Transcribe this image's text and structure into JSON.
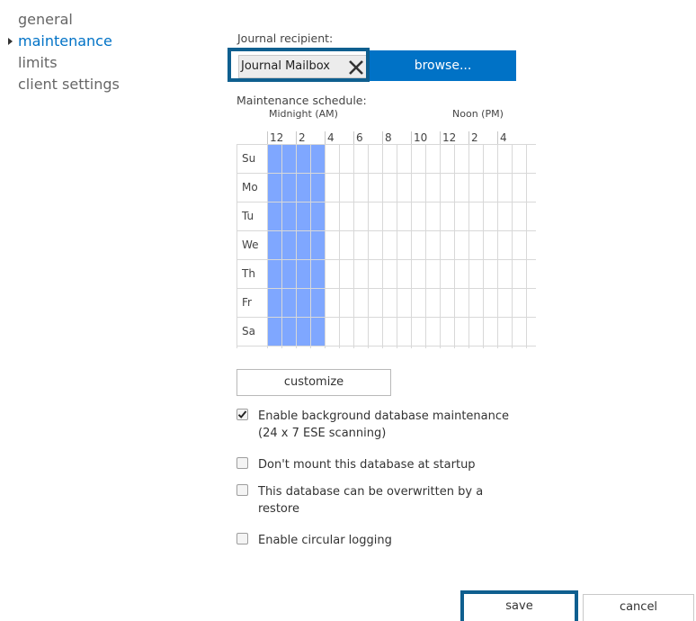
{
  "nav": {
    "items": [
      {
        "label": "general",
        "active": false
      },
      {
        "label": "maintenance",
        "active": true
      },
      {
        "label": "limits",
        "active": false
      },
      {
        "label": "client settings",
        "active": false
      }
    ]
  },
  "journal": {
    "label": "Journal recipient:",
    "value": "Journal Mailbox",
    "remove_icon": "close-x-icon",
    "browse_label": "browse..."
  },
  "schedule": {
    "label": "Maintenance schedule:",
    "midnight_label": "Midnight (AM)",
    "noon_label": "Noon (PM)",
    "hour_ticks": [
      "12",
      "2",
      "4",
      "6",
      "8",
      "10",
      "12",
      "2",
      "4"
    ],
    "days": [
      "Su",
      "Mo",
      "Tu",
      "We",
      "Th",
      "Fr",
      "Sa"
    ],
    "selected_hours": [
      1,
      2,
      3,
      4
    ],
    "selected_color": "#7fa7ff",
    "customize_label": "customize"
  },
  "options": [
    {
      "label": "Enable background database maintenance (24 x 7 ESE scanning)",
      "checked": true
    },
    {
      "label": "Don't mount this database at startup",
      "checked": false
    },
    {
      "label": "This database can be overwritten by a restore",
      "checked": false
    },
    {
      "label": "Enable circular logging",
      "checked": false
    }
  ],
  "footer": {
    "save_label": "save",
    "cancel_label": "cancel"
  },
  "colors": {
    "accent": "#0072c6",
    "highlight_border": "#0f5f8f"
  }
}
